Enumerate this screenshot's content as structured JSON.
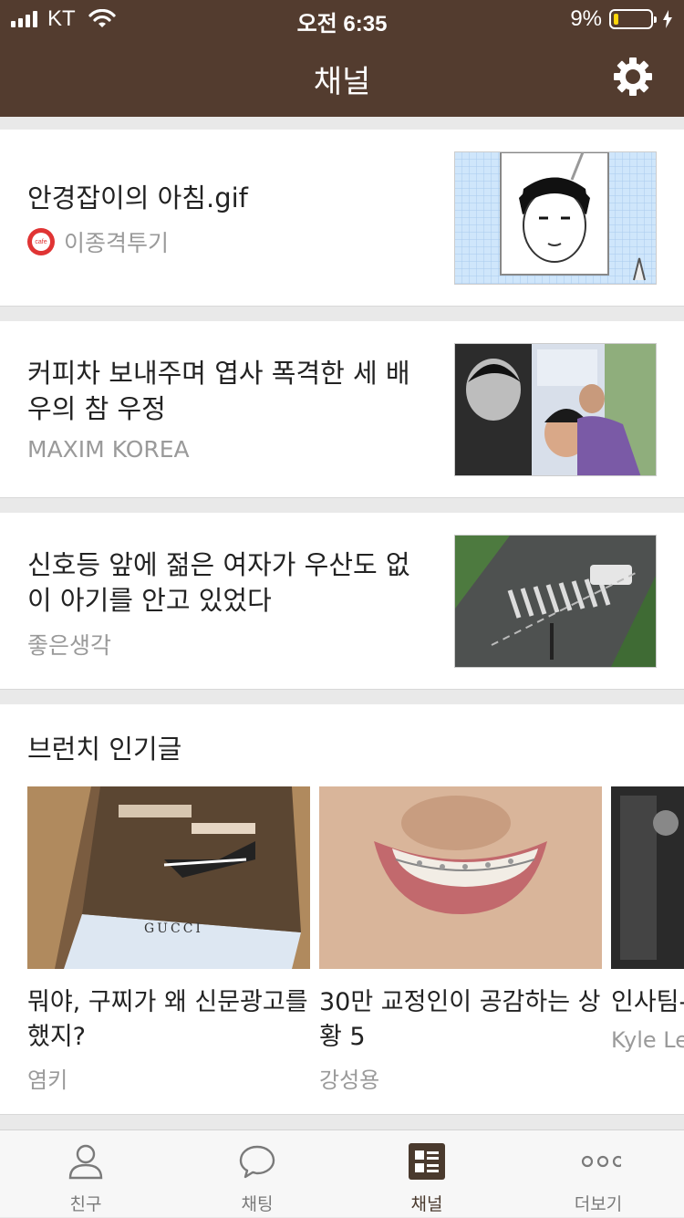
{
  "status_bar": {
    "carrier": "KT",
    "time": "오전 6:35",
    "battery": "9%"
  },
  "header": {
    "title": "채널"
  },
  "cards": [
    {
      "headline": "안경잡이의 아침.gif",
      "source": "이종격투기",
      "source_icon": "cafe",
      "cafe_label": "cafe"
    },
    {
      "headline": "커피차 보내주며 엽사 폭격한 세 배우의 참 우정",
      "source": "MAXIM KOREA"
    },
    {
      "headline": "신호등 앞에 젊은 여자가 우산도 없이 아기를 안고 있었다",
      "source": "좋은생각"
    }
  ],
  "brunch": {
    "title": "브런치 인기글",
    "items": [
      {
        "title": "뭐야, 구찌가 왜 신문광고를 했지?",
        "author": "염키",
        "image_text": "GUCCI"
      },
      {
        "title": "30만 교정인이 공감하는 상황 5",
        "author": "강성용"
      },
      {
        "title": "인사팀-나요?",
        "author": "Kyle Le"
      }
    ]
  },
  "tabs": [
    {
      "label": "친구",
      "icon": "person-icon"
    },
    {
      "label": "채팅",
      "icon": "chat-bubble-icon"
    },
    {
      "label": "채널",
      "icon": "channel-icon",
      "active": true
    },
    {
      "label": "더보기",
      "icon": "more-dots-icon"
    }
  ],
  "colors": {
    "header_bg": "#533c2f",
    "background": "#e9e9e9",
    "card_bg": "#ffffff"
  }
}
